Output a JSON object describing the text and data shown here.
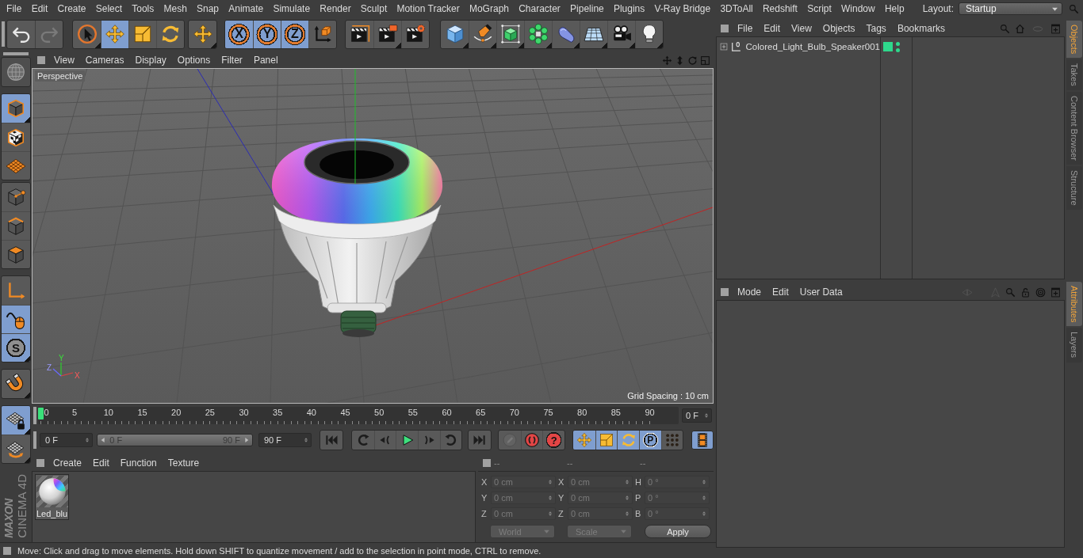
{
  "menu_bar": {
    "items": [
      "File",
      "Edit",
      "Create",
      "Select",
      "Tools",
      "Mesh",
      "Snap",
      "Animate",
      "Simulate",
      "Render",
      "Sculpt",
      "Motion Tracker",
      "MoGraph",
      "Character",
      "Pipeline",
      "Plugins",
      "V-Ray Bridge",
      "3DToAll",
      "Redshift",
      "Script",
      "Window",
      "Help"
    ],
    "layout_label": "Layout:",
    "layout_value": "Startup"
  },
  "toolbar": {
    "groups": [
      [
        {
          "kind": "undo",
          "selected": false,
          "disabled": false
        },
        {
          "kind": "redo",
          "selected": false,
          "disabled": true
        }
      ],
      [
        {
          "kind": "select",
          "selected": false,
          "menu": true
        },
        {
          "kind": "move",
          "selected": true
        },
        {
          "kind": "scale",
          "selected": false
        },
        {
          "kind": "rotate",
          "selected": false
        }
      ],
      [
        {
          "kind": "recent",
          "selected": false,
          "menu": true
        }
      ],
      [
        {
          "kind": "axis",
          "label": "X",
          "selected": true
        },
        {
          "kind": "axis",
          "label": "Y",
          "selected": true
        },
        {
          "kind": "axis",
          "label": "Z",
          "selected": true
        },
        {
          "kind": "coords",
          "selected": false
        }
      ],
      [
        {
          "kind": "renderview",
          "selected": false
        },
        {
          "kind": "render",
          "selected": false,
          "menu": true
        },
        {
          "kind": "rendersettings",
          "selected": false
        }
      ],
      [
        {
          "kind": "cube",
          "selected": false,
          "menu": true
        },
        {
          "kind": "pen",
          "selected": false,
          "menu": true
        },
        {
          "kind": "subdivision",
          "selected": false,
          "menu": true
        },
        {
          "kind": "cloner",
          "selected": false,
          "menu": true
        },
        {
          "kind": "deformer",
          "selected": false,
          "menu": true
        },
        {
          "kind": "floor",
          "selected": false,
          "menu": true
        },
        {
          "kind": "camera",
          "selected": false,
          "menu": true
        },
        {
          "kind": "light",
          "selected": false,
          "menu": true
        }
      ]
    ]
  },
  "left_toolbar": {
    "groups": [
      [
        {
          "kind": "globe",
          "selected": false
        }
      ],
      [
        {
          "kind": "model",
          "selected": true,
          "menu": true
        },
        {
          "kind": "texture",
          "selected": false
        },
        {
          "kind": "workplane",
          "selected": false
        }
      ],
      [
        {
          "kind": "points",
          "selected": false
        },
        {
          "kind": "edges",
          "selected": false
        },
        {
          "kind": "polygons",
          "selected": false
        }
      ],
      [
        {
          "kind": "axismode",
          "selected": false
        },
        {
          "kind": "tweak",
          "selected": true
        },
        {
          "kind": "solo",
          "label": "S",
          "selected": true,
          "menu": true
        }
      ],
      [
        {
          "kind": "snap",
          "selected": false,
          "menu": true
        }
      ],
      [
        {
          "kind": "lock",
          "selected": true,
          "menu": true
        },
        {
          "kind": "planar",
          "selected": false,
          "menu": true
        }
      ]
    ],
    "logo_brand": "MAXON",
    "logo_product": "CINEMA 4D"
  },
  "viewport": {
    "menu": [
      "View",
      "Cameras",
      "Display",
      "Options",
      "Filter",
      "Panel"
    ],
    "camera": "Perspective",
    "grid_spacing": "Grid Spacing : 10 cm",
    "axis_labels": [
      "X",
      "Y",
      "Z"
    ]
  },
  "timeline": {
    "frames": [
      "0",
      "5",
      "10",
      "15",
      "20",
      "25",
      "30",
      "35",
      "40",
      "45",
      "50",
      "55",
      "60",
      "65",
      "70",
      "75",
      "80",
      "85",
      "90"
    ],
    "level": 0,
    "current_frame": "0 F",
    "start": "0 F",
    "range_slider": {
      "start": "0 F",
      "end": "90 F",
      "level": 1
    },
    "end": "90 F",
    "transport": [
      [
        {
          "kind": "first"
        }
      ],
      [
        {
          "kind": "prevkey"
        },
        {
          "kind": "prevframe"
        },
        {
          "kind": "play"
        },
        {
          "kind": "nextframe"
        },
        {
          "kind": "nextkey"
        }
      ],
      [
        {
          "kind": "last"
        }
      ]
    ],
    "record": [
      {
        "kind": "keylock",
        "disabled": true
      },
      {
        "kind": "record",
        "disabled": false
      },
      {
        "kind": "autokey",
        "label": "?",
        "disabled": false
      }
    ],
    "keys": [
      {
        "kind": "keymove",
        "selected": true
      },
      {
        "kind": "keyscale",
        "selected": true
      },
      {
        "kind": "keyrotate",
        "selected": true
      },
      {
        "kind": "param",
        "label": "P",
        "selected": true
      },
      {
        "kind": "pla",
        "selected": false
      }
    ],
    "timeline_view": {
      "selected": true
    }
  },
  "materials": {
    "menu": [
      "Create",
      "Edit",
      "Function",
      "Texture"
    ],
    "items": [
      {
        "name": "Led_blu",
        "selected": false
      }
    ]
  },
  "coordinates": {
    "headers": [
      "--",
      "--",
      "--"
    ],
    "rows": [
      {
        "axis": "X",
        "position": "0 cm",
        "size_axis": "X",
        "size": "0 cm",
        "rotation_axis": "H",
        "rotation": "0 °"
      },
      {
        "axis": "Y",
        "position": "0 cm",
        "size_axis": "Y",
        "size": "0 cm",
        "rotation_axis": "P",
        "rotation": "0 °"
      },
      {
        "axis": "Z",
        "position": "0 cm",
        "size_axis": "Z",
        "size": "0 cm",
        "rotation_axis": "B",
        "rotation": "0 °"
      }
    ],
    "disabled": true,
    "mode": "World",
    "scale_mode": "Scale",
    "apply": "Apply"
  },
  "objects_panel": {
    "menu": [
      "File",
      "Edit",
      "View",
      "Objects",
      "Tags",
      "Bookmarks"
    ],
    "objects": [
      {
        "name": "Colored_Light_Bulb_Speaker001",
        "expanded": false
      }
    ]
  },
  "attributes_panel": {
    "menu": [
      "Mode",
      "Edit",
      "User Data"
    ]
  },
  "side_tabs": {
    "upper": [
      {
        "label": "Objects",
        "selected": true
      },
      {
        "label": "Takes",
        "selected": false
      },
      {
        "label": "Content Browser",
        "selected": false
      },
      {
        "label": "Structure",
        "selected": false
      }
    ],
    "lower": [
      {
        "label": "Attributes",
        "selected": true
      },
      {
        "label": "Layers",
        "selected": false
      }
    ]
  },
  "status_bar": {
    "text": "Move: Click and drag to move elements. Hold down SHIFT to quantize movement / add to the selection in point mode, CTRL to remove."
  }
}
